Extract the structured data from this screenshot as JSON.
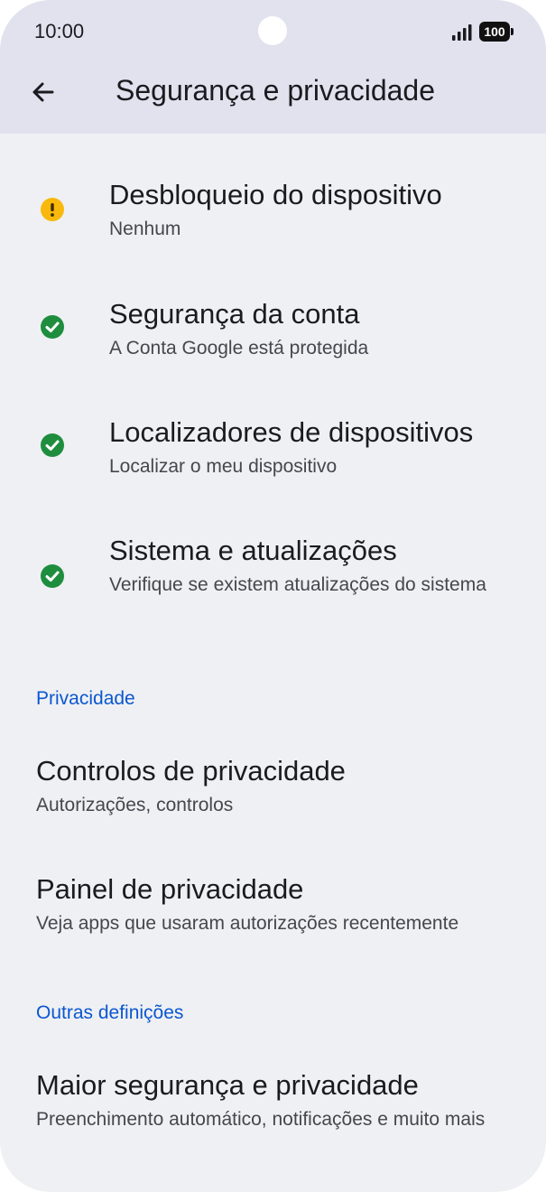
{
  "status_bar": {
    "time": "10:00",
    "battery": "100"
  },
  "header": {
    "title": "Segurança e privacidade"
  },
  "security_items": [
    {
      "title": "Desbloqueio do dispositivo",
      "subtitle": "Nenhum",
      "status": "warning",
      "status_color": "#f9b90c"
    },
    {
      "title": "Segurança da conta",
      "subtitle": "A Conta Google está protegida",
      "status": "ok",
      "status_color": "#1e8e3e"
    },
    {
      "title": "Localizadores de dispositivos",
      "subtitle": "Localizar o meu dispositivo",
      "status": "ok",
      "status_color": "#1e8e3e"
    },
    {
      "title": "Sistema e atualizações",
      "subtitle": "Verifique se existem atualizações do sistema",
      "status": "ok",
      "status_color": "#1e8e3e"
    }
  ],
  "privacy_section": {
    "header": "Privacidade",
    "items": [
      {
        "title": "Controlos de privacidade",
        "subtitle": "Autorizações, controlos"
      },
      {
        "title": "Painel de privacidade",
        "subtitle": "Veja apps que usaram autorizações recentemente"
      }
    ]
  },
  "other_section": {
    "header": "Outras definições",
    "items": [
      {
        "title": "Maior segurança e privacidade",
        "subtitle": "Preenchimento automático, notificações e muito mais"
      }
    ]
  },
  "colors": {
    "accent": "#0b57d0",
    "header_bg": "#e1e2ee",
    "page_bg": "#eff0f3"
  }
}
